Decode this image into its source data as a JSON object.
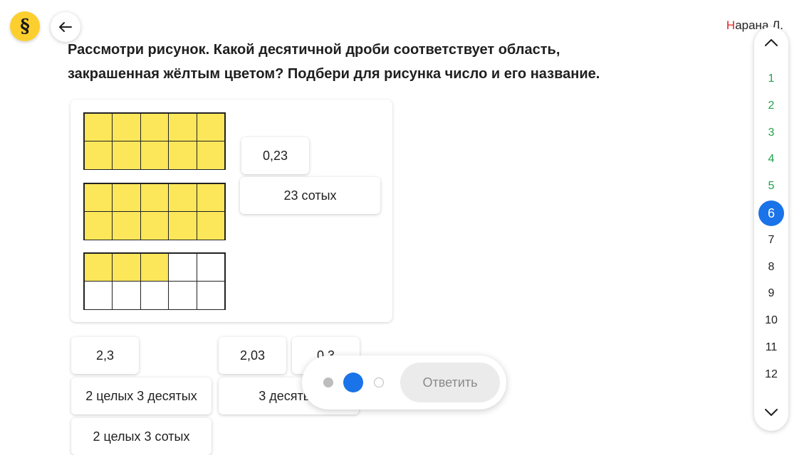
{
  "header": {
    "logo_glyph": "§",
    "username_first": "Н",
    "username_rest": "арана Л."
  },
  "question": {
    "text": "Рассмотри рисунок. Какой десятичной дроби соответствует область, закрашенная жёлтым цветом? Подбери для рисунка число и его название."
  },
  "figure": {
    "fill_color": "#fce75a",
    "grids": [
      {
        "filled_cells": 10,
        "total_cells": 10
      },
      {
        "filled_cells": 10,
        "total_cells": 10
      },
      {
        "filled_cells": 3,
        "total_cells": 10
      }
    ],
    "placed_answers": [
      "0,23",
      "23 сотых"
    ]
  },
  "options": {
    "row1": [
      "2,3",
      "2,03",
      "0,3"
    ],
    "row2": [
      "2 целых 3 десятых",
      "3 десятых"
    ],
    "row3": [
      "2 целых 3 сотых"
    ]
  },
  "answer_bar": {
    "submit_label": "Ответить",
    "dots": [
      "grey",
      "blue",
      "empty"
    ]
  },
  "question_nav": {
    "numbers": [
      "1",
      "2",
      "3",
      "4",
      "5",
      "6",
      "7",
      "8",
      "9",
      "10",
      "11",
      "12"
    ],
    "done": [
      "1",
      "2",
      "3",
      "4",
      "5"
    ],
    "active": "6",
    "done_color": "#21a34a",
    "active_color": "#1a73e8"
  }
}
